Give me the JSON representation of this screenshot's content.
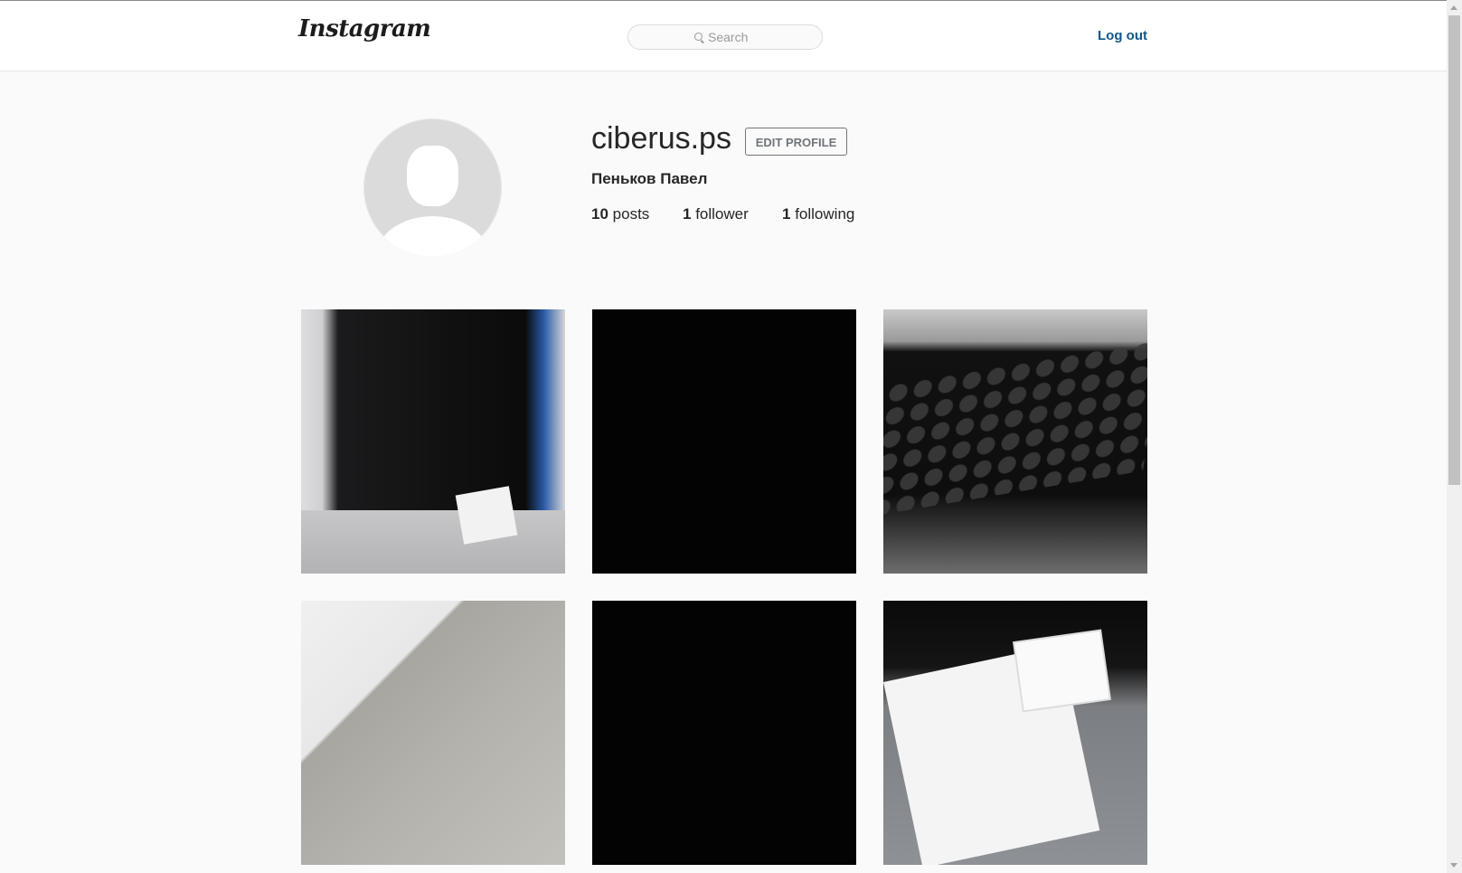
{
  "header": {
    "logo": "Instagram",
    "search_placeholder": "Search",
    "logout_label": "Log out"
  },
  "profile": {
    "username": "ciberus.ps",
    "edit_profile_label": "EDIT PROFILE",
    "full_name": "Пеньков Павел",
    "posts_count": "10",
    "posts_label": "posts",
    "followers_count": "1",
    "followers_label": "follower",
    "following_count": "1",
    "following_label": "following"
  },
  "colors": {
    "accent_link": "#125688",
    "background": "#fafafa"
  },
  "icons": {
    "search": "search-icon",
    "avatar": "default-avatar-icon"
  }
}
